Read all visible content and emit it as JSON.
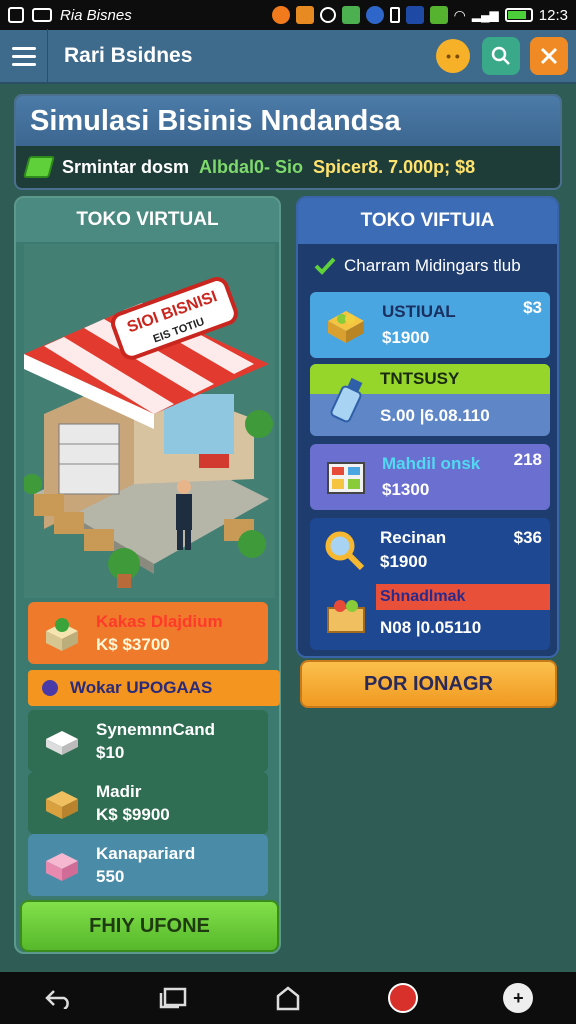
{
  "status_bar": {
    "app_label": "Ria Bisnes",
    "clock": "12:3"
  },
  "app_bar": {
    "title": "Rari Bsidnes",
    "search_icon": "search-icon",
    "close_icon": "close-icon"
  },
  "banner": {
    "title": "Simulasi Bisinis Nndandsa",
    "stats_text": "Srmintar dosm",
    "stats_green": "Albdal0- Sio",
    "stats_value": "Spicer8. 7.000p; $8"
  },
  "left_panel": {
    "header": "TOKO VIRTUAL",
    "sign": {
      "line1": "SIOI BISNISI",
      "line2": "EIS TOTIU"
    },
    "items": [
      {
        "name": "Kakas Dlajdium",
        "price": "K$ $3700",
        "icon": "plant-box-icon"
      },
      {
        "name": "SynemnnCand",
        "price": "$10",
        "icon": "tissue-box-icon"
      },
      {
        "name": "Madir",
        "price": "K$ $9900",
        "icon": "cardboard-box-icon"
      },
      {
        "name": "Kanapariard",
        "price": "550",
        "icon": "gift-box-icon"
      }
    ],
    "upgrade_strip": "Wokar UPOGAAS",
    "button": "FHIY UFONE"
  },
  "right_panel": {
    "header": "TOKO VIFTUIA",
    "check_text": "Charram Midingars tlub",
    "cards": [
      {
        "name": "USTIUAL",
        "price": "$1900",
        "corner_price": "$3",
        "icon": "fruit-basket-icon"
      },
      {
        "name": "TNTSUSY",
        "price": "S.00 |6.08.110",
        "corner_price": "",
        "icon": "bottle-icon"
      },
      {
        "name": "Mahdil onsk",
        "price": "$1300",
        "corner_price": "218",
        "icon": "display-shelf-icon"
      },
      {
        "name": "Recinan",
        "price": "$1900",
        "corner_price": "$36",
        "icon": "magnifier-icon"
      },
      {
        "name": "Shnadlmak",
        "price": "N08 |0.05110",
        "corner_price": "",
        "icon": "produce-crate-icon"
      }
    ],
    "button": "POR IONAGR"
  },
  "colors": {
    "background": "#2f5d55",
    "green_button": "#6fd13b",
    "orange_button": "#f3a73c",
    "appbar": "#3e6b8c"
  }
}
